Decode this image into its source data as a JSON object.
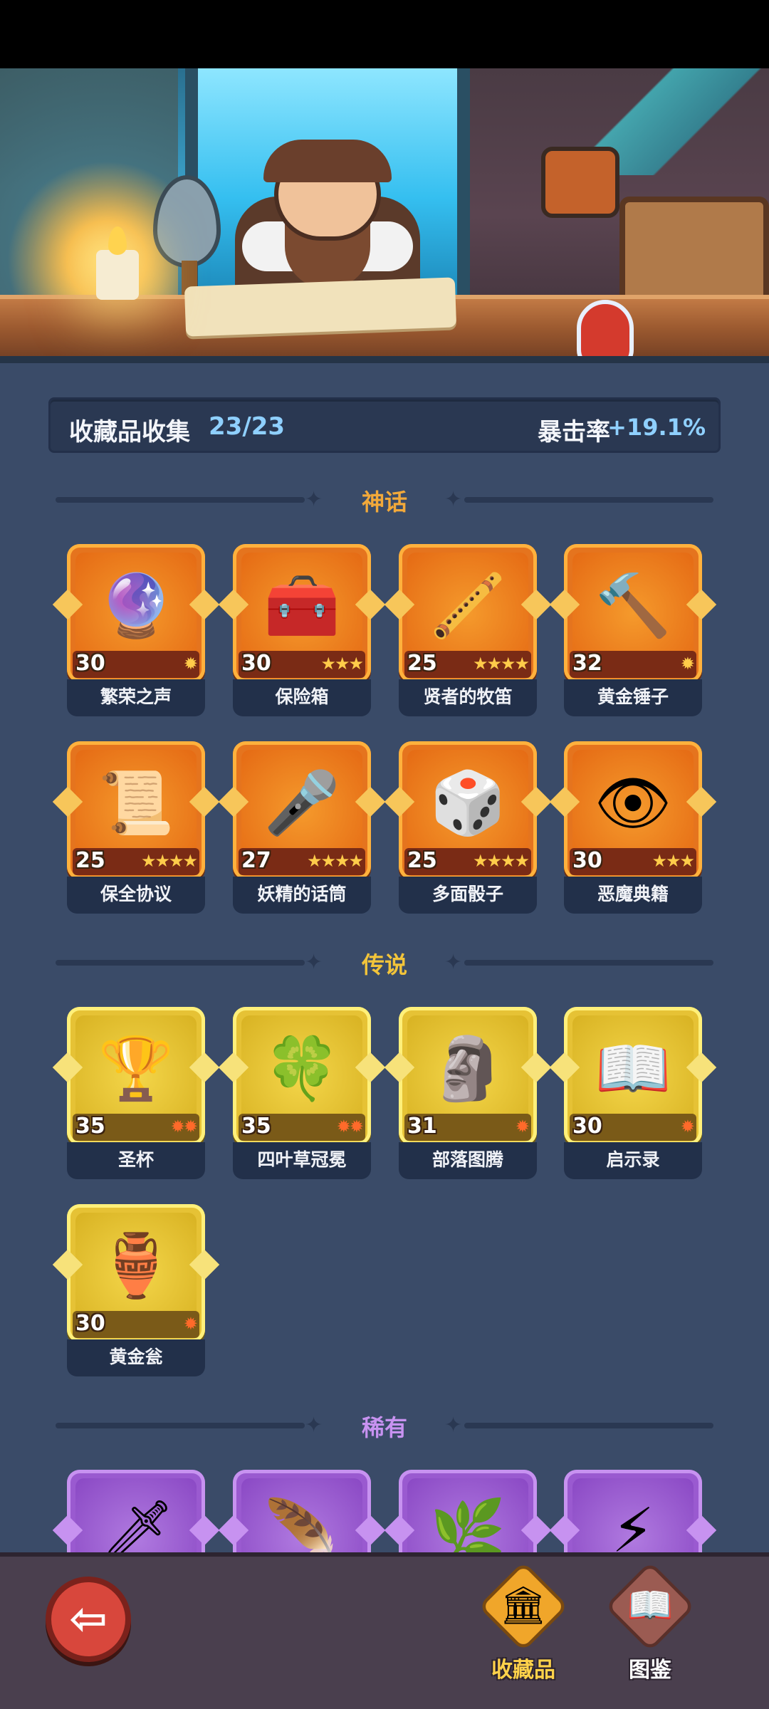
{
  "header": {
    "collection_label": "收藏品收集",
    "collection_count": "23/23",
    "crit_label": "暴击率",
    "crit_value": "+19.1%"
  },
  "sections": {
    "mythic": "神话",
    "legend": "传说",
    "rare": "稀有"
  },
  "mythic_items": [
    {
      "name": "繁荣之声",
      "level": "30",
      "stars": "✹",
      "icon": "orb-icon"
    },
    {
      "name": "保险箱",
      "level": "30",
      "stars": "★★★",
      "icon": "treasure-chest-icon"
    },
    {
      "name": "贤者的牧笛",
      "level": "25",
      "stars": "★★★★",
      "icon": "flute-icon"
    },
    {
      "name": "黄金锤子",
      "level": "32",
      "stars": "✹",
      "icon": "hammer-icon"
    },
    {
      "name": "保全协议",
      "level": "25",
      "stars": "★★★★",
      "icon": "contract-icon"
    },
    {
      "name": "妖精的话筒",
      "level": "27",
      "stars": "★★★★",
      "icon": "microphone-icon"
    },
    {
      "name": "多面骰子",
      "level": "25",
      "stars": "★★★★",
      "icon": "dice-icon"
    },
    {
      "name": "恶魔典籍",
      "level": "30",
      "stars": "★★★",
      "icon": "demon-book-icon"
    }
  ],
  "legend_items": [
    {
      "name": "圣杯",
      "level": "35",
      "stars": "✹✹",
      "icon": "grail-icon"
    },
    {
      "name": "四叶草冠冕",
      "level": "35",
      "stars": "✹✹",
      "icon": "clover-crown-icon"
    },
    {
      "name": "部落图腾",
      "level": "31",
      "stars": "✹",
      "icon": "totem-icon"
    },
    {
      "name": "启示录",
      "level": "30",
      "stars": "✹",
      "icon": "open-book-icon"
    },
    {
      "name": "黄金瓮",
      "level": "30",
      "stars": "✹",
      "icon": "urn-icon"
    }
  ],
  "rare_items": [
    {
      "icon": "ice-sword-icon"
    },
    {
      "icon": "feather-icon"
    },
    {
      "icon": "vine-icon"
    },
    {
      "icon": "lightning-scroll-icon"
    }
  ],
  "nav": {
    "back": "⇦",
    "collect_label": "收藏品",
    "book_label": "图鉴"
  }
}
